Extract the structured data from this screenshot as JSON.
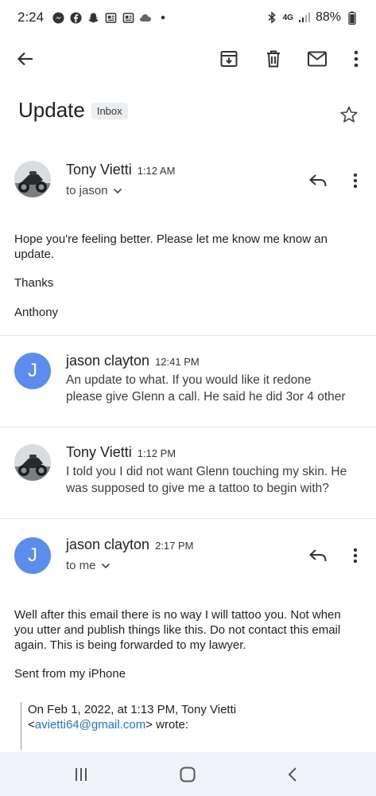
{
  "status_bar": {
    "time": "2:24",
    "battery": "88%",
    "network": "4G"
  },
  "toolbar": {
    "back": "back",
    "archive": "archive",
    "delete": "delete",
    "mark_unread": "mark unread",
    "more": "more"
  },
  "subject": "Update",
  "label": "Inbox",
  "messages": [
    {
      "sender": "Tony Vietti",
      "time": "1:12 AM",
      "recipient": "to jason",
      "body": [
        "Hope you're feeling better. Please let me know me know an update.",
        "Thanks",
        "Anthony"
      ]
    },
    {
      "sender": "jason clayton",
      "time": "12:41 PM",
      "avatar_letter": "J",
      "snippet_1": "An update to what. If you would like it redone",
      "snippet_2": "please give Glenn a call. He said he did 3or 4 other"
    },
    {
      "sender": "Tony Vietti",
      "time": "1:12 PM",
      "snippet_1": "I told you I did not want Glenn touching my skin. He",
      "snippet_2": "was supposed to give me a tattoo to begin with?"
    },
    {
      "sender": "jason clayton",
      "time": "2:17 PM",
      "avatar_letter": "J",
      "recipient": "to me",
      "body_1": "Well after this email there is no way I will tattoo you. Not when you utter and publish things like this. Do not contact this email again. This is being forwarded to my lawyer.",
      "body_2": "Sent from my iPhone",
      "quote_1": "On Feb 1, 2022, at 1:13 PM, Tony Vietti",
      "quote_email": "avietti64@gmail.com",
      "quote_open": "<",
      "quote_close": "> wrote:"
    }
  ],
  "colors": {
    "accent": "#5b8def",
    "link": "#1a73e8",
    "nav_bg": "#f1f3f8"
  }
}
